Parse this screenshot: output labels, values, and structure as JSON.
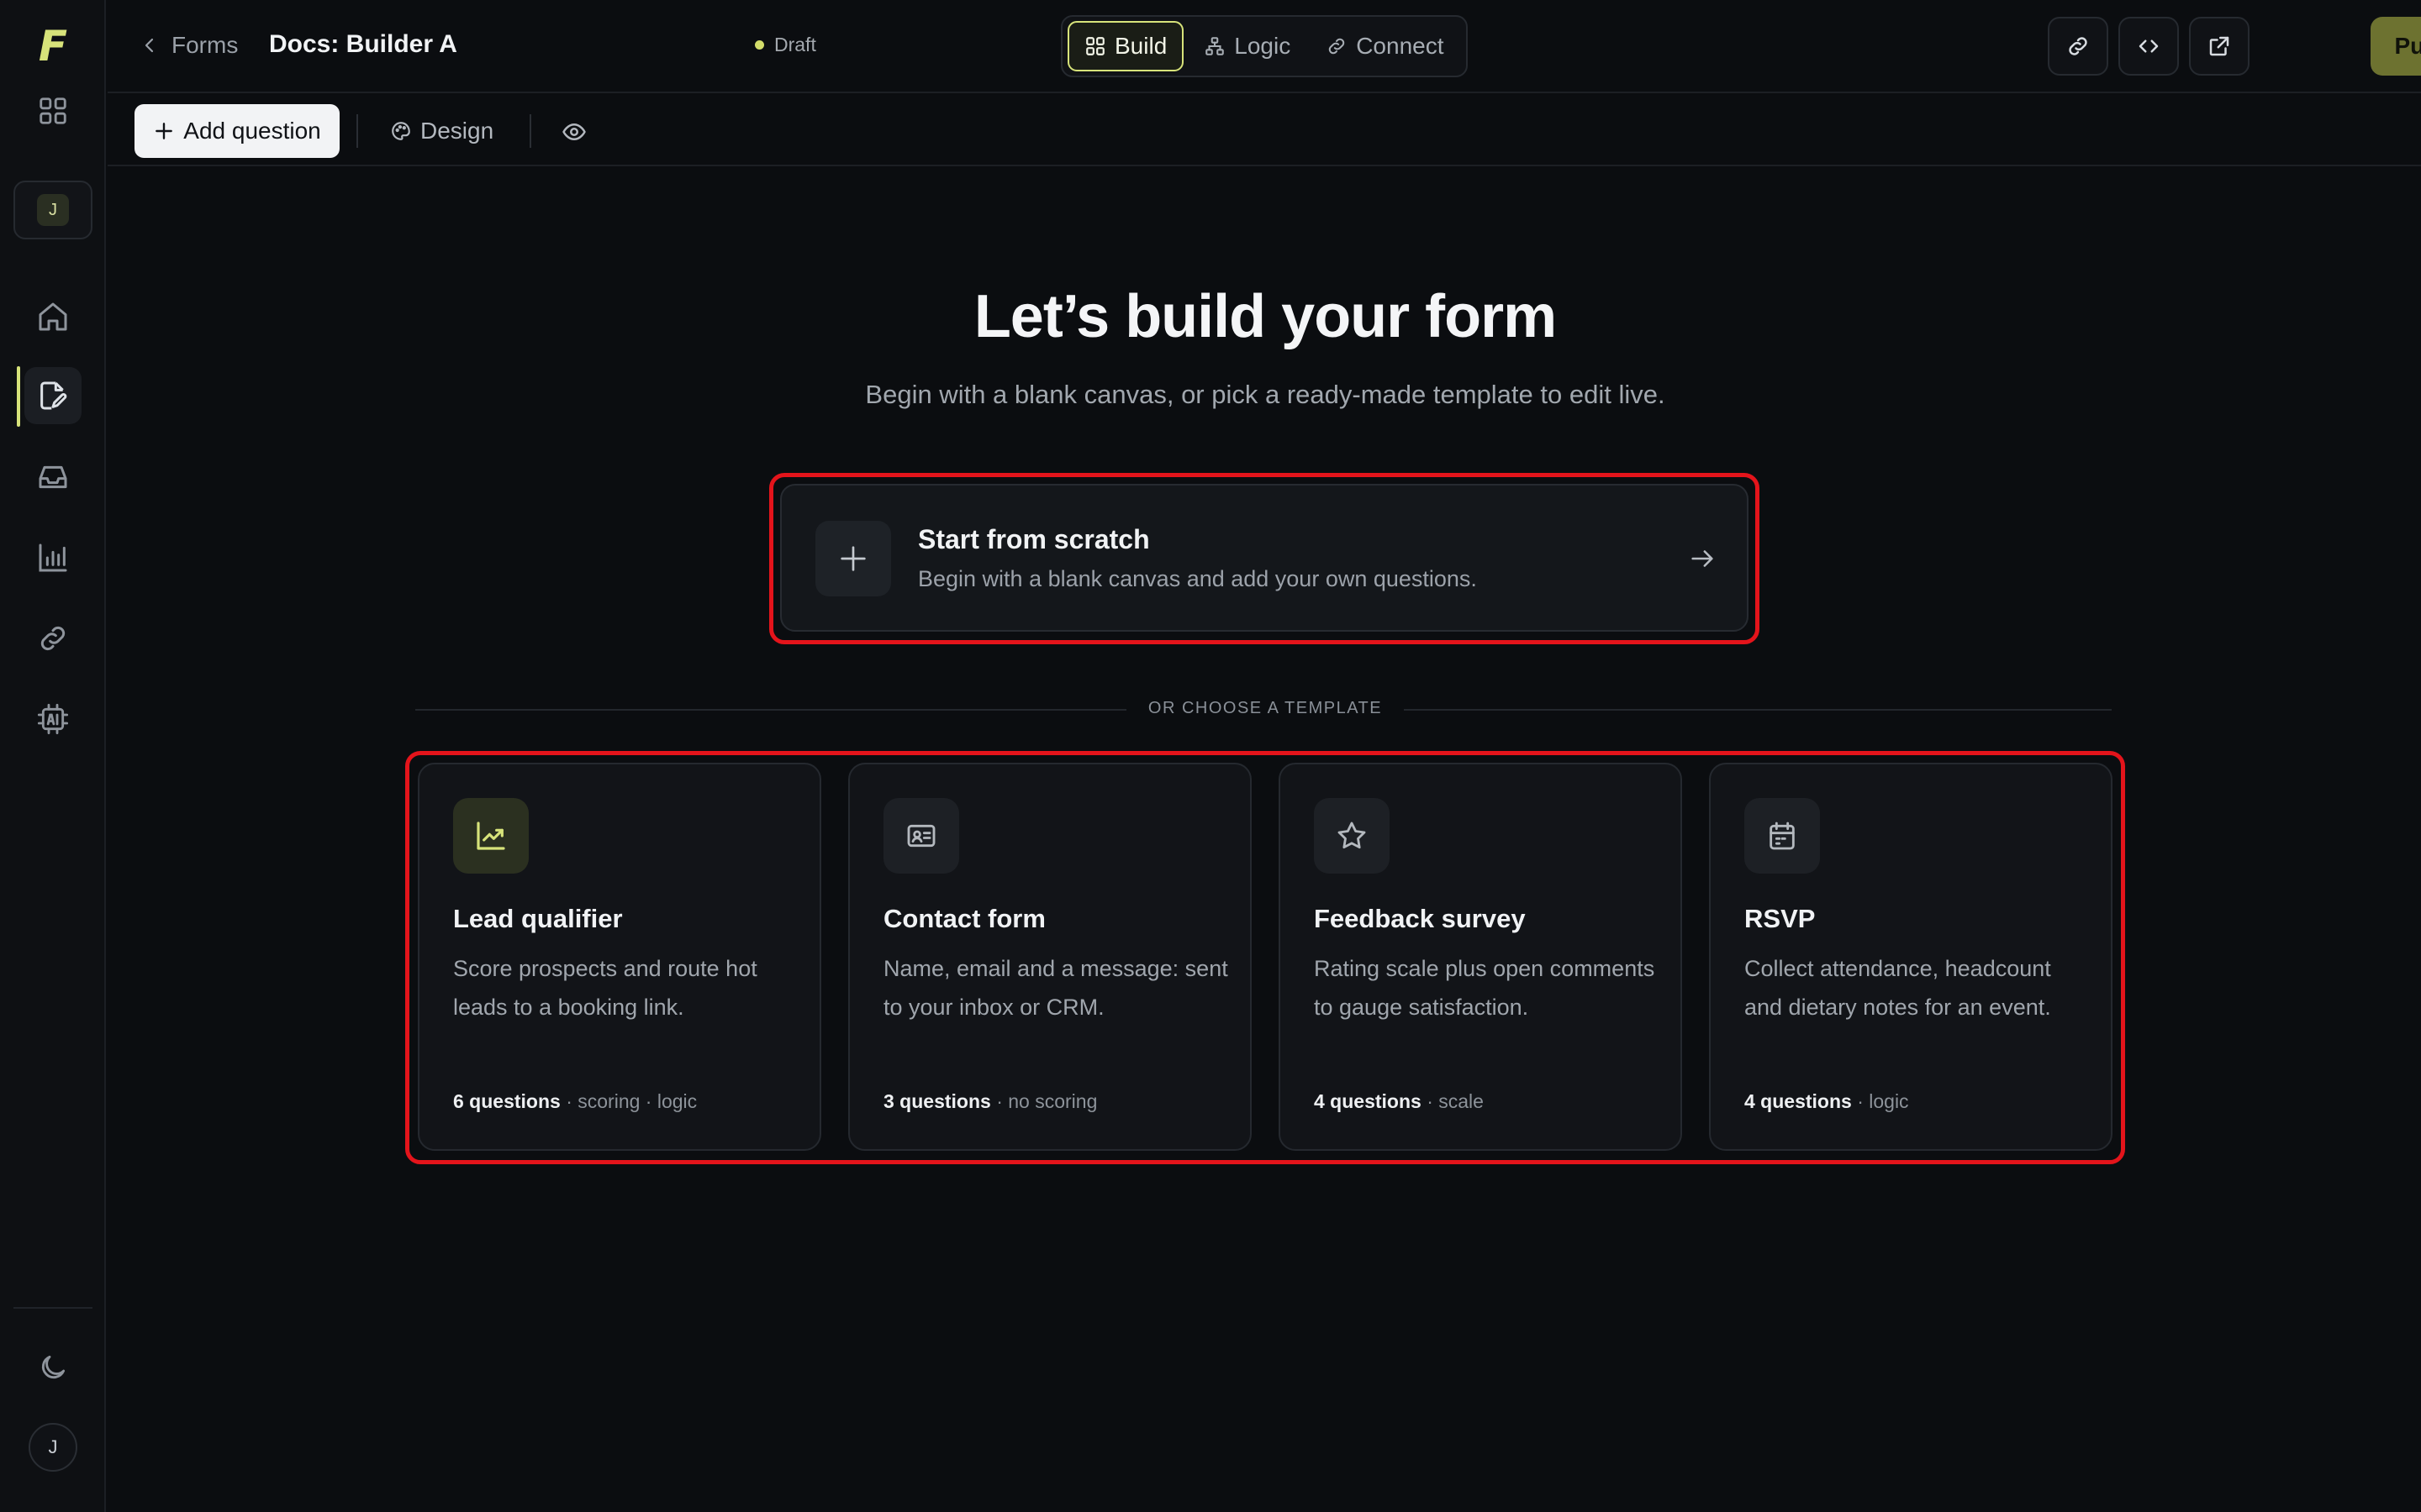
{
  "app": {
    "logo": "F",
    "workspace_initial": "J",
    "user_initial": "J"
  },
  "rail": {
    "items": [
      {
        "name": "apps-grid-icon"
      },
      {
        "name": "home-icon"
      },
      {
        "name": "forms-edit-icon",
        "active": true
      },
      {
        "name": "inbox-icon"
      },
      {
        "name": "analytics-icon"
      },
      {
        "name": "link-icon"
      },
      {
        "name": "ai-chip-icon"
      },
      {
        "name": "moon-icon"
      }
    ]
  },
  "header": {
    "back_label": "Forms",
    "doc_title": "Docs: Builder A",
    "status": "Draft",
    "tabs": [
      {
        "label": "Build",
        "active": true
      },
      {
        "label": "Logic"
      },
      {
        "label": "Connect"
      }
    ],
    "publish_label": "Publish"
  },
  "toolbar": {
    "add_question_label": "Add question",
    "design_label": "Design"
  },
  "main": {
    "title": "Let’s build your form",
    "subtitle": "Begin with a blank canvas, or pick a ready-made template to edit live.",
    "scratch": {
      "title": "Start from scratch",
      "description": "Begin with a blank canvas and add your own questions."
    },
    "divider_label": "OR CHOOSE A TEMPLATE",
    "templates": [
      {
        "title": "Lead qualifier",
        "description": "Score prospects and route hot leads to a booking link.",
        "count": "6 questions",
        "tags": " · scoring · logic",
        "icon": "trend-chart-icon"
      },
      {
        "title": "Contact form",
        "description": "Name, email and a message: sent to your inbox or CRM.",
        "count": "3 questions",
        "tags": " · no scoring",
        "icon": "contact-card-icon"
      },
      {
        "title": "Feedback survey",
        "description": "Rating scale plus open comments to gauge satisfaction.",
        "count": "4 questions",
        "tags": " · scale",
        "icon": "star-icon"
      },
      {
        "title": "RSVP",
        "description": "Collect attendance, headcount and dietary notes for an event.",
        "count": "4 questions",
        "tags": " · logic",
        "icon": "calendar-icon"
      }
    ]
  },
  "colors": {
    "accent": "#d7e37a",
    "highlight": "#e4141b",
    "publish_bg": "#6d7230"
  }
}
